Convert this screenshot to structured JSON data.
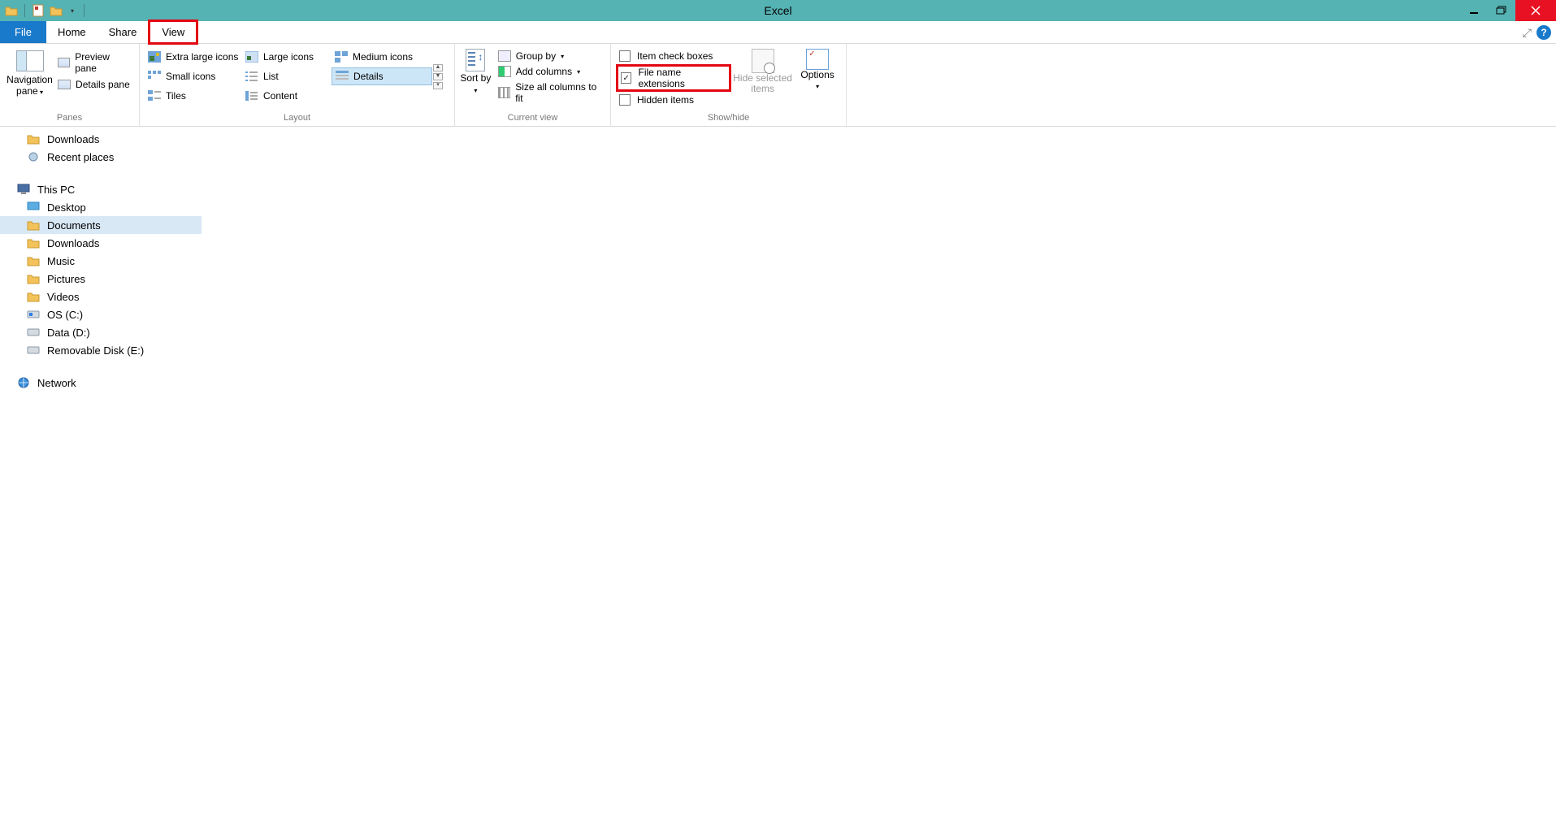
{
  "window": {
    "title": "Excel"
  },
  "tabs": {
    "file": "File",
    "home": "Home",
    "share": "Share",
    "view": "View"
  },
  "ribbon": {
    "panes": {
      "group_label": "Panes",
      "navigation_pane": "Navigation pane",
      "preview_pane": "Preview pane",
      "details_pane": "Details pane"
    },
    "layout": {
      "group_label": "Layout",
      "extra_large_icons": "Extra large icons",
      "large_icons": "Large icons",
      "medium_icons": "Medium icons",
      "small_icons": "Small icons",
      "list": "List",
      "details": "Details",
      "tiles": "Tiles",
      "content": "Content"
    },
    "current_view": {
      "group_label": "Current view",
      "sort_by": "Sort by",
      "group_by": "Group by",
      "add_columns": "Add columns",
      "size_all_columns": "Size all columns to fit"
    },
    "show_hide": {
      "group_label": "Show/hide",
      "item_check_boxes": "Item check boxes",
      "file_name_extensions": "File name extensions",
      "hidden_items": "Hidden items",
      "hide_selected": "Hide selected items",
      "options": "Options"
    }
  },
  "nav_tree": {
    "downloads": "Downloads",
    "recent_places": "Recent places",
    "this_pc": "This PC",
    "desktop": "Desktop",
    "documents": "Documents",
    "downloads2": "Downloads",
    "music": "Music",
    "pictures": "Pictures",
    "videos": "Videos",
    "os_c": "OS (C:)",
    "data_d": "Data (D:)",
    "removable_e": "Removable Disk (E:)",
    "network": "Network"
  }
}
